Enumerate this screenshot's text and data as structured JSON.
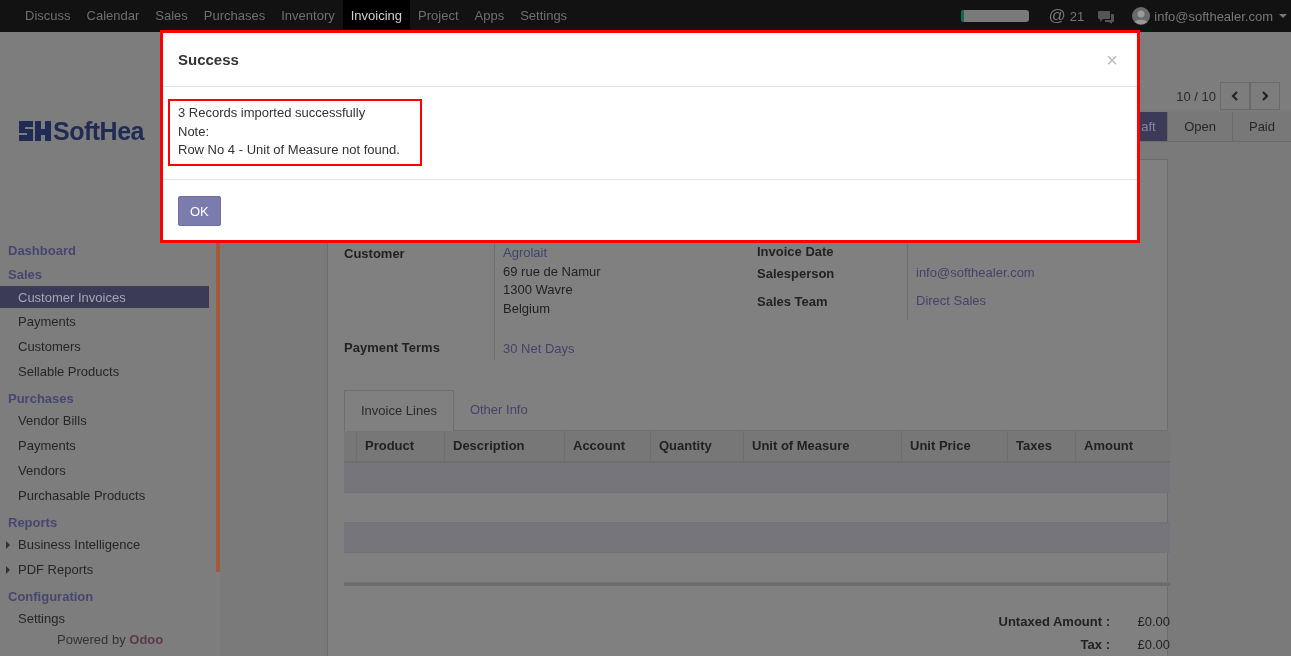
{
  "navbar": {
    "menus": [
      {
        "label": "Discuss",
        "selected": false
      },
      {
        "label": "Calendar",
        "selected": false
      },
      {
        "label": "Sales",
        "selected": false
      },
      {
        "label": "Purchases",
        "selected": false
      },
      {
        "label": "Inventory",
        "selected": false
      },
      {
        "label": "Invoicing",
        "selected": true
      },
      {
        "label": "Project",
        "selected": false
      },
      {
        "label": "Apps",
        "selected": false
      },
      {
        "label": "Settings",
        "selected": false
      }
    ],
    "progress": {
      "level": 0.05
    },
    "mention_icon": "@",
    "mention_count": "21",
    "user": "info@softhealer.com"
  },
  "sidebar": {
    "logo_text": "SoftHea",
    "sections": [
      {
        "title": "Dashboard"
      },
      {
        "title": "Sales",
        "items": [
          {
            "label": "Customer Invoices",
            "selected": true
          },
          {
            "label": "Payments",
            "selected": false
          },
          {
            "label": "Customers",
            "selected": false
          },
          {
            "label": "Sellable Products",
            "selected": false
          }
        ]
      },
      {
        "title": "Purchases",
        "items": [
          {
            "label": "Vendor Bills",
            "selected": false
          },
          {
            "label": "Payments",
            "selected": false
          },
          {
            "label": "Vendors",
            "selected": false
          },
          {
            "label": "Purchasable Products",
            "selected": false
          }
        ]
      },
      {
        "title": "Reports",
        "items": [
          {
            "label": "Business Intelligence",
            "selected": false,
            "expanded": false
          },
          {
            "label": "PDF Reports",
            "selected": false,
            "expanded": false
          }
        ]
      },
      {
        "title": "Configuration",
        "items": [
          {
            "label": "Settings",
            "selected": false
          }
        ]
      }
    ],
    "footer": "Powered by **Odoo**"
  },
  "pager": "10 / 10",
  "status_steps": [
    {
      "label": "aft",
      "selected": true
    },
    {
      "label": "Open",
      "selected": false
    },
    {
      "label": "Paid",
      "selected": false
    }
  ],
  "form": {
    "left": [
      {
        "label": "Customer",
        "link": "Agrolait",
        "lines": [
          "69 rue de Namur",
          "1300 Wavre",
          "Belgium"
        ]
      },
      {
        "label": "Payment Terms",
        "link": "30 Net Days"
      }
    ],
    "right": [
      {
        "label": "Invoice Date"
      },
      {
        "label": "Salesperson",
        "link": "info@softhealer.com"
      },
      {
        "label": "Sales Team",
        "link": "Direct Sales"
      }
    ]
  },
  "tabs": [
    {
      "label": "Invoice Lines",
      "selected": true
    },
    {
      "label": "Other Info",
      "selected": false
    }
  ],
  "table": {
    "columns": [
      "Product",
      "Description",
      "Account",
      "Quantity",
      "Unit of Measure",
      "Unit Price",
      "Taxes",
      "Amount"
    ]
  },
  "totals": [
    {
      "label": "Untaxed Amount :",
      "value": "£0.00"
    },
    {
      "label": "Tax :",
      "value": "£0.00"
    }
  ],
  "modal": {
    "title": "Success",
    "close": "×",
    "message": [
      "3 Records imported successfully",
      "Note:",
      "Row No 4  - Unit of Measure not found."
    ],
    "button": "OK"
  }
}
